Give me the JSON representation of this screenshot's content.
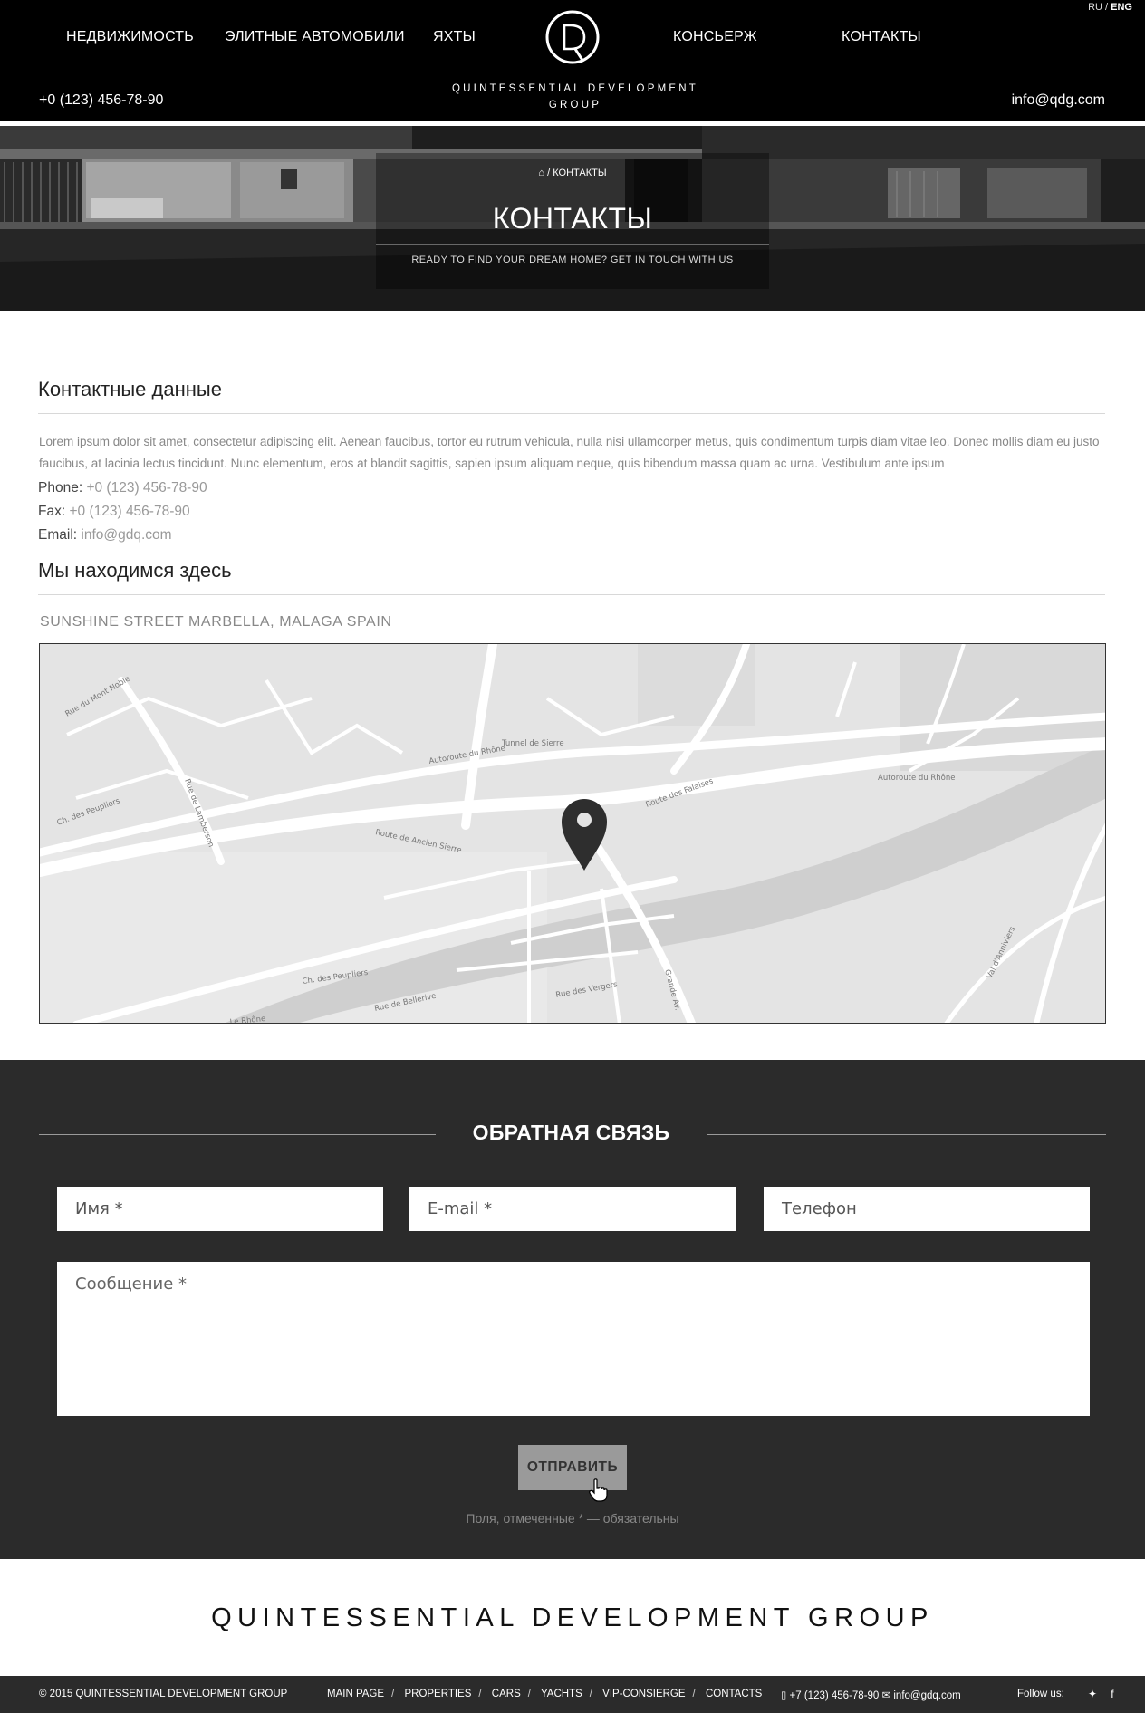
{
  "header": {
    "lang": {
      "ru": "RU",
      "sep": " / ",
      "eng": "ENG"
    },
    "nav": [
      "НЕДВИЖИМОСТЬ",
      "ЭЛИТНЫЕ АВТОМОБИЛИ",
      "ЯХТЫ",
      "КОНСЬЕРЖ",
      "КОНТАКТЫ"
    ],
    "logo_line1": "QUINTESSENTIAL DEVELOPMENT",
    "logo_line2": "GROUP",
    "phone": "+0 (123) 456-78-90",
    "email": "info@qdg.com"
  },
  "hero": {
    "breadcrumb_current": "КОНТАКТЫ",
    "breadcrumb_sep": "/",
    "home_icon": "home-icon",
    "title": "КОНТАКТЫ",
    "subtitle": "READY TO FIND YOUR DREAM HOME? GET IN TOUCH WITH US"
  },
  "contact": {
    "title": "Контактные данные",
    "text": "Lorem ipsum dolor sit amet, consectetur adipiscing elit. Aenean faucibus, tortor eu rutrum vehicula, nulla nisi ullamcorper metus, quis condimentum turpis diam vitae leo. Donec mollis diam eu justo faucibus, at lacinia lectus tincidunt. Nunc elementum, eros at blandit sagittis, sapien ipsum aliquam neque, quis bibendum massa quam ac urna. Vestibulum ante ipsum",
    "phone_label": "Phone:",
    "phone": "+0 (123) 456-78-90",
    "fax_label": "Fax:",
    "fax": "+0 (123) 456-78-90",
    "email_label": "Email:",
    "email": "info@gdq.com"
  },
  "location": {
    "title": "Мы находимся здесь",
    "address": "SUNSHINE STREET MARBELLA, MALAGA SPAIN",
    "map_labels": [
      "Tunnel de Sierre",
      "Autoroute du Rhône",
      "Route de Ancien Sierre",
      "Route des Falaises",
      "Autoroute du Rhône",
      "Rue de Bellerive",
      "Ch. des Peupliers",
      "Le Rhône",
      "Val d'Anniviers",
      "Rue du Mont Noble",
      "Rue de Lamberson",
      "Rue des Vergers",
      "Grande Av.",
      "Ch. des Peupliers"
    ],
    "marker_icon": "map-marker-icon"
  },
  "feedback": {
    "title": "ОБРАТНАЯ СВЯЗЬ",
    "name_placeholder": "Имя *",
    "email_placeholder": "E-mail *",
    "phone_placeholder": "Телефон",
    "message_placeholder": "Сообщение *",
    "submit_label": "ОТПРАВИТЬ",
    "note": "Поля, отмеченные * — обязательны"
  },
  "footer": {
    "brand": "QUINTESSENTIAL DEVELOPMENT GROUP",
    "copyright": "© 2015 QUINTESSENTIAL DEVELOPMENT GROUP",
    "links": [
      "MAIN PAGE",
      "PROPERTIES",
      "CARS",
      "YACHTS",
      "VIP-CONSIERGE",
      "CONTACTS"
    ],
    "phone": "+7 (123) 456-78-90",
    "email": "info@gdq.com",
    "follow": "Follow us:",
    "social": [
      "twitter-icon",
      "facebook-icon"
    ]
  }
}
